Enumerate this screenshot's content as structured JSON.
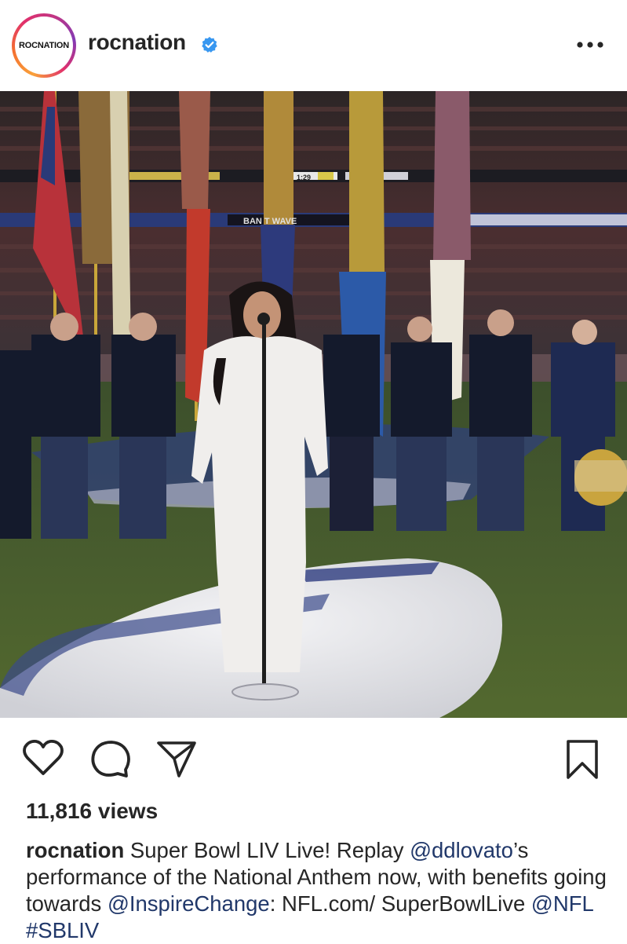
{
  "post": {
    "account": {
      "username": "rocnation",
      "avatar_text": "ROCNATION",
      "verified": true
    },
    "media": {
      "scoreboard_text": "BAN   T WAVE",
      "clock_text": "1:29"
    },
    "actions": {
      "like_icon": "heart-icon",
      "comment_icon": "comment-icon",
      "share_icon": "paper-plane-icon",
      "save_icon": "bookmark-icon"
    },
    "views": "11,816 views",
    "caption": {
      "username": "rocnation",
      "text_1": " Super Bowl LIV Live! Replay ",
      "mention_1": "@ddlovato",
      "text_2": "’s performance of the National Anthem now, with benefits going towards ",
      "mention_2": "@InspireChange",
      "text_3": ": NFL.com/ SuperBowlLive ",
      "mention_3": "@NFL",
      "text_4": " ",
      "hashtag": "#SBLIV"
    }
  },
  "colors": {
    "verified_blue": "#3897f0",
    "link_blue": "#21386a",
    "text": "#262626"
  }
}
